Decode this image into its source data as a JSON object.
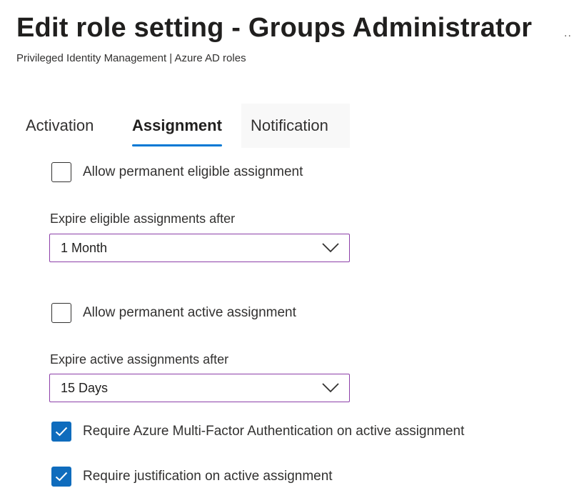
{
  "header": {
    "title": "Edit role setting - Groups Administrator",
    "more": "..",
    "subtitle": "Privileged Identity Management | Azure AD roles"
  },
  "tabs": [
    {
      "label": "Activation",
      "selected": false
    },
    {
      "label": "Assignment",
      "selected": true
    },
    {
      "label": "Notification",
      "selected": false
    }
  ],
  "assignment": {
    "permanent_eligible": {
      "label": "Allow permanent eligible assignment",
      "checked": false
    },
    "expire_eligible": {
      "label": "Expire eligible assignments after",
      "value": "1 Month"
    },
    "permanent_active": {
      "label": "Allow permanent active assignment",
      "checked": false
    },
    "expire_active": {
      "label": "Expire active assignments after",
      "value": "15 Days"
    },
    "require_mfa": {
      "label": "Require Azure Multi-Factor Authentication on active assignment",
      "checked": true
    },
    "require_justification": {
      "label": "Require justification on active assignment",
      "checked": true
    }
  },
  "colors": {
    "accent": "#0078d4",
    "checkbox_checked": "#0f6cbd",
    "dropdown_border": "#8c3fa8"
  },
  "icons": {
    "more": "ellipsis-icon",
    "dropdown": "chevron-down-icon",
    "check": "checkmark-icon"
  }
}
